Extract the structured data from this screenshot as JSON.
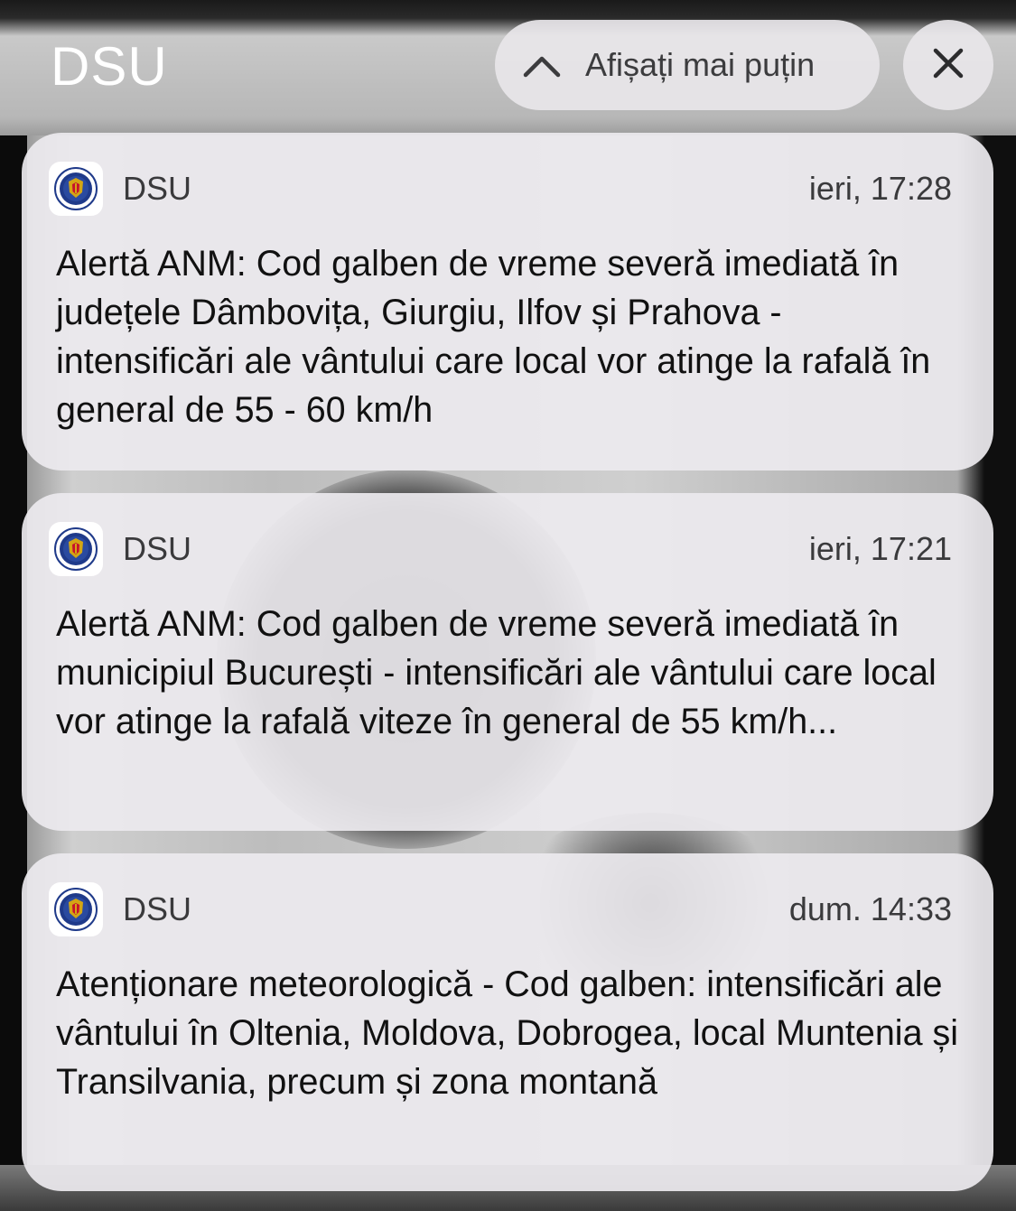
{
  "header": {
    "title": "DSU",
    "show_less_label": "Afișați mai puțin",
    "show_less_icon": "chevron-up-icon",
    "close_icon": "close-icon"
  },
  "notifications": [
    {
      "app_name": "DSU",
      "time": "ieri, 17:28",
      "body": "Alertă ANM: Cod galben de vreme severă imediată în județele Dâmbovița, Giurgiu, Ilfov și Prahova - intensificări ale vântului care local vor atinge la rafală în general de 55 - 60 km/h"
    },
    {
      "app_name": "DSU",
      "time": "ieri, 17:21",
      "body": "Alertă ANM: Cod galben de vreme severă imediată în municipiul București - intensificări ale vântului care local vor atinge la rafală viteze în general de 55 km/h..."
    },
    {
      "app_name": "DSU",
      "time": "dum. 14:33",
      "body": "Atenționare meteorologică - Cod galben: intensificări ale vântului în Oltenia, Moldova, Dobrogea, local Muntenia și Transilvania, precum și zona montană"
    }
  ],
  "colors": {
    "card_background": "#ECEAEE",
    "pill_background": "#E8E6E9",
    "text_primary": "#111111",
    "text_secondary": "#3A3A3C",
    "emblem_blue": "#1F3A8A",
    "emblem_gold": "#D4A514",
    "emblem_red": "#C8102E"
  }
}
